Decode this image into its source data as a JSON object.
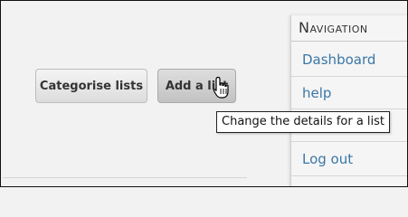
{
  "toolbar": {
    "categorise_label": "Categorise lists",
    "add_label": "Add a list"
  },
  "tooltip": {
    "text": "Change the details for a list"
  },
  "navigation": {
    "heading": "Navigation",
    "items": [
      {
        "label": "Dashboard"
      },
      {
        "label": "help"
      },
      {
        "label": ""
      },
      {
        "label": "Log out"
      }
    ]
  },
  "cursor": {
    "icon": "hand-pointer-icon"
  },
  "colors": {
    "link": "#3a77a6",
    "background": "#f2f2f2"
  }
}
